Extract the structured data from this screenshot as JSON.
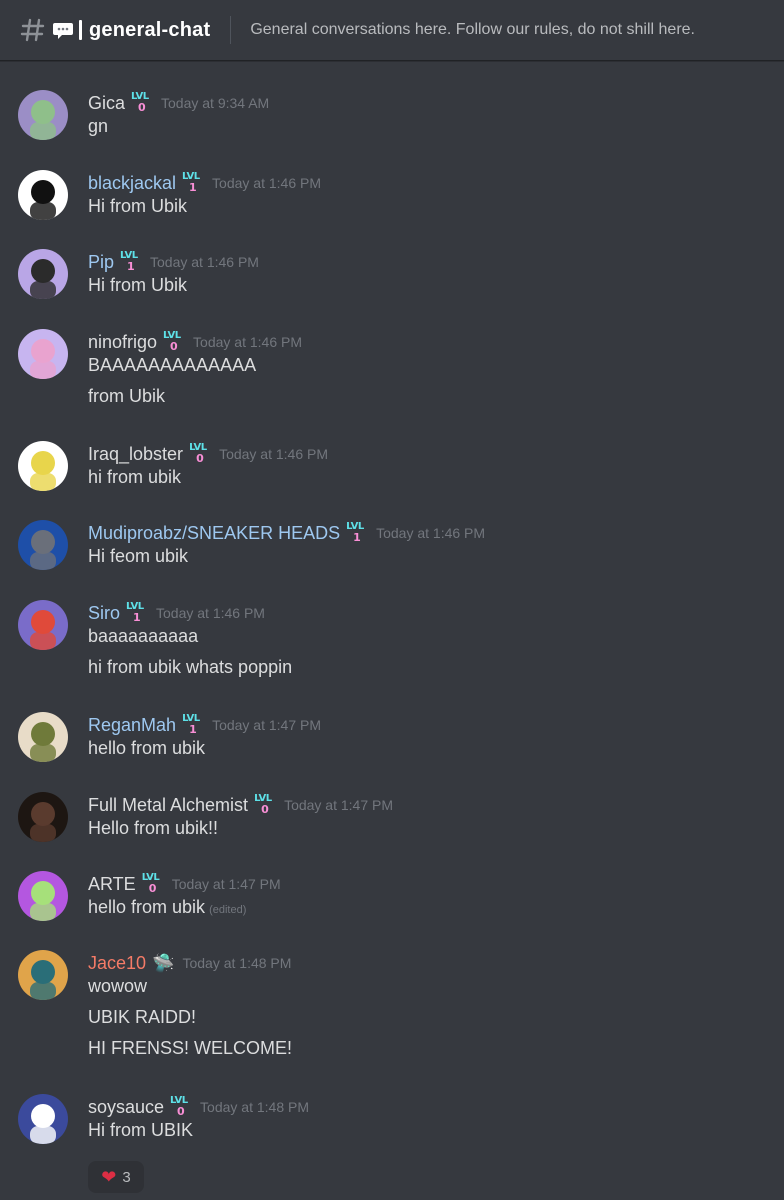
{
  "header": {
    "channel_name": "general-chat",
    "topic": "General conversations here. Follow our rules, do not shill here.",
    "icons": [
      "hash-icon",
      "speech-bubble-icon"
    ]
  },
  "badge": {
    "text": "LVL"
  },
  "messages": [
    {
      "username": "Gica",
      "name_color": "#dcddde",
      "level": "0",
      "time": "Today at 9:34 AM",
      "lines": [
        "gn"
      ],
      "avatar_color": "#8fbf8a",
      "avatar_bg": "#9b8ec6"
    },
    {
      "username": "blackjackal",
      "name_color": "#9ec8f0",
      "level": "1",
      "time": "Today at 1:46 PM",
      "lines": [
        "Hi from Ubik"
      ],
      "avatar_color": "#111111",
      "avatar_bg": "#ffffff"
    },
    {
      "username": "Pip",
      "name_color": "#9ec8f0",
      "level": "1",
      "time": "Today at 1:46 PM",
      "lines": [
        "Hi from Ubik"
      ],
      "avatar_color": "#2b2b2b",
      "avatar_bg": "#b9a6e6"
    },
    {
      "username": "ninofrigo",
      "name_color": "#dcddde",
      "level": "0",
      "time": "Today at 1:46 PM",
      "lines": [
        "BAAAAAAAAAAAAA",
        "from Ubik"
      ],
      "avatar_color": "#e9a3cf",
      "avatar_bg": "#c7b5f0"
    },
    {
      "username": "Iraq_lobster",
      "name_color": "#dcddde",
      "level": "0",
      "time": "Today at 1:46 PM",
      "lines": [
        "hi from ubik"
      ],
      "avatar_color": "#e8d54b",
      "avatar_bg": "#ffffff"
    },
    {
      "username": "Mudiproabz/SNEAKER HEADS",
      "name_color": "#9ec8f0",
      "level": "1",
      "time": "Today at 1:46 PM",
      "lines": [
        "Hi feom ubik"
      ],
      "avatar_color": "#6a6f7a",
      "avatar_bg": "#1e4fa8"
    },
    {
      "username": "Siro",
      "name_color": "#9ec8f0",
      "level": "1",
      "time": "Today at 1:46 PM",
      "lines": [
        "baaaaaaaaaa",
        "hi from ubik whats poppin"
      ],
      "avatar_color": "#e04a3a",
      "avatar_bg": "#7a6cc9"
    },
    {
      "username": "ReganMah",
      "name_color": "#9ec8f0",
      "level": "1",
      "time": "Today at 1:47 PM",
      "lines": [
        "hello from ubik"
      ],
      "avatar_color": "#6f7a3a",
      "avatar_bg": "#e8dcc8"
    },
    {
      "username": "Full Metal Alchemist",
      "name_color": "#dcddde",
      "level": "0",
      "time": "Today at 1:47 PM",
      "lines": [
        "Hello from ubik!!"
      ],
      "avatar_color": "#5a3b2e",
      "avatar_bg": "#1d1612"
    },
    {
      "username": "ARTE",
      "name_color": "#dcddde",
      "level": "0",
      "time": "Today at 1:47 PM",
      "lines": [
        "hello from ubik"
      ],
      "edited": "(edited)",
      "avatar_color": "#a6e07a",
      "avatar_bg": "#b457e0"
    },
    {
      "username": "Jace10",
      "name_color": "#f47b67",
      "level": "",
      "badge_icon": "ufo-icon",
      "time": "Today at 1:48 PM",
      "lines": [
        "wowow",
        "UBIK RAIDD!",
        "HI FRENSS! WELCOME!"
      ],
      "avatar_color": "#2a6e78",
      "avatar_bg": "#e0a44a"
    },
    {
      "username": "soysauce",
      "name_color": "#dcddde",
      "level": "0",
      "time": "Today at 1:48 PM",
      "lines": [
        "Hi from UBIK"
      ],
      "avatar_color": "#ffffff",
      "avatar_bg": "#3b4a9c",
      "reaction": {
        "emoji": "heart-icon",
        "count": "3"
      }
    }
  ]
}
